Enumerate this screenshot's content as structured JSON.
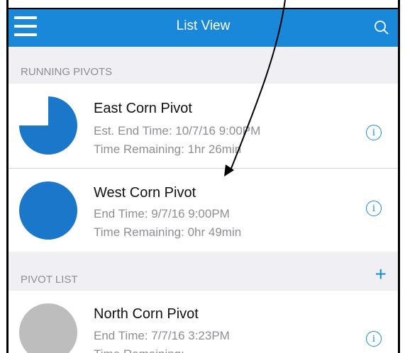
{
  "nav": {
    "title": "List View",
    "menu_icon": "hamburger-menu-icon",
    "search_icon": "search-icon"
  },
  "running": {
    "header": "RUNNING PIVOTS",
    "items": [
      {
        "name": "East Corn Pivot",
        "time": "Est. End Time: 10/7/16  9:00PM",
        "remaining": "Time Remaining: 1hr 26min",
        "progress": 0.75,
        "color": "#1a77c9"
      },
      {
        "name": "West Corn Pivot",
        "time": "End Time: 9/7/16  9:00PM",
        "remaining": "Time Remaining: 0hr 49min",
        "progress": 1.0,
        "color": "#1a77c9"
      }
    ]
  },
  "pivot_list": {
    "header": "PIVOT LIST",
    "add_label": "+",
    "items": [
      {
        "name": "North Corn Pivot",
        "time": "End Time: 7/7/16  3:23PM",
        "remaining": "Time Remaining: ...",
        "color": "#bdbdbd"
      }
    ]
  },
  "info_label": "i"
}
